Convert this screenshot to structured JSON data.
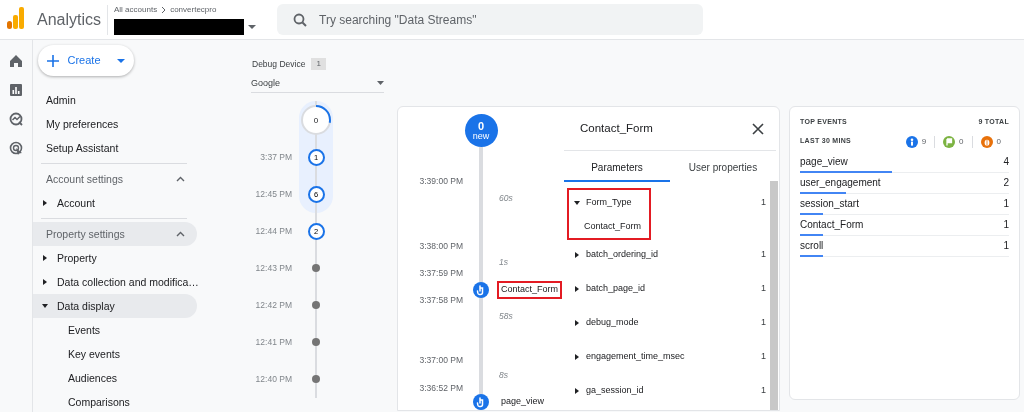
{
  "app": {
    "name": "Analytics"
  },
  "account": {
    "breadcrumb": [
      "All accounts",
      "convertecpro"
    ],
    "redacted": true
  },
  "search": {
    "placeholder": "Try searching \"Data Streams\""
  },
  "rail": [
    {
      "kind": "home"
    },
    {
      "kind": "reports"
    },
    {
      "kind": "explore"
    },
    {
      "kind": "advertising"
    }
  ],
  "create_button": {
    "label": "Create"
  },
  "sidebar": {
    "links": [
      "Admin",
      "My preferences",
      "Setup Assistant"
    ],
    "sections": [
      {
        "title": "Account settings",
        "expanded": true,
        "highlighted": false,
        "items": [
          {
            "label": "Account",
            "expanded": false,
            "selected": false
          }
        ]
      },
      {
        "title": "Property settings",
        "expanded": true,
        "highlighted": true,
        "items": [
          {
            "label": "Property",
            "expanded": false,
            "selected": false
          },
          {
            "label": "Data collection and modifica…",
            "expanded": false,
            "selected": false
          },
          {
            "label": "Data display",
            "expanded": true,
            "selected": true,
            "children": [
              "Events",
              "Key events",
              "Audiences",
              "Comparisons"
            ]
          }
        ]
      }
    ]
  },
  "debug_device": {
    "label": "Debug Device",
    "count": "1",
    "value": "Google"
  },
  "device_timeline": [
    {
      "kind": "current",
      "count": "0",
      "level": 0.28,
      "selected": true
    },
    {
      "kind": "active",
      "time": "3:37 PM",
      "count": "1",
      "selected": true
    },
    {
      "kind": "active",
      "time": "12:45 PM",
      "count": "6",
      "selected": true
    },
    {
      "kind": "active",
      "time": "12:44 PM",
      "count": "2",
      "selected": false
    },
    {
      "kind": "idle",
      "time": "12:43 PM",
      "selected": false
    },
    {
      "kind": "idle",
      "time": "12:42 PM",
      "selected": false
    },
    {
      "kind": "idle",
      "time": "12:41 PM",
      "selected": false
    },
    {
      "kind": "idle",
      "time": "12:40 PM",
      "selected": false
    }
  ],
  "stream": {
    "new": {
      "count": "0",
      "label": "new"
    },
    "items": [
      {
        "kind": "time",
        "text": "3:39:00 PM"
      },
      {
        "kind": "duration",
        "text": "60s"
      },
      {
        "kind": "time",
        "text": "3:38:00 PM"
      },
      {
        "kind": "duration",
        "text": "1s"
      },
      {
        "kind": "time",
        "text": "3:37:59 PM"
      },
      {
        "kind": "event",
        "text": "Contact_Form",
        "highlighted": true
      },
      {
        "kind": "time",
        "text": "3:37:58 PM"
      },
      {
        "kind": "duration",
        "text": "58s"
      },
      {
        "kind": "time",
        "text": "3:37:00 PM"
      },
      {
        "kind": "duration",
        "text": "8s"
      },
      {
        "kind": "time",
        "text": "3:36:52 PM"
      },
      {
        "kind": "event",
        "text": "page_view",
        "highlighted": false
      }
    ]
  },
  "detail": {
    "title": "Contact_Form",
    "tabs": [
      {
        "label": "Parameters",
        "selected": true
      },
      {
        "label": "User properties",
        "selected": false
      }
    ],
    "parameters": [
      {
        "name": "Form_Type",
        "count": "1",
        "expanded": true,
        "highlighted": true,
        "value": "Contact_Form"
      },
      {
        "name": "batch_ordering_id",
        "count": "1",
        "expanded": false,
        "highlighted": false
      },
      {
        "name": "batch_page_id",
        "count": "1",
        "expanded": false,
        "highlighted": false
      },
      {
        "name": "debug_mode",
        "count": "1",
        "expanded": false,
        "highlighted": false
      },
      {
        "name": "engagement_time_msec",
        "count": "1",
        "expanded": false,
        "highlighted": false
      },
      {
        "name": "ga_session_id",
        "count": "1",
        "expanded": false,
        "highlighted": false
      }
    ]
  },
  "top_events": {
    "title": "TOP EVENTS",
    "total": "9 TOTAL",
    "period": "LAST 30 MINS",
    "counters": [
      {
        "kind": "event",
        "count": "9",
        "color": "#1a73e8"
      },
      {
        "kind": "conversion",
        "count": "0",
        "color": "#7cb342"
      },
      {
        "kind": "error",
        "count": "0",
        "color": "#e8710a"
      }
    ],
    "events": [
      {
        "name": "page_view",
        "count": "4",
        "level": 0.44
      },
      {
        "name": "user_engagement",
        "count": "2",
        "level": 0.22
      },
      {
        "name": "session_start",
        "count": "1",
        "level": 0.11
      },
      {
        "name": "Contact_Form",
        "count": "1",
        "level": 0.11
      },
      {
        "name": "scroll",
        "count": "1",
        "level": 0.11
      }
    ]
  }
}
